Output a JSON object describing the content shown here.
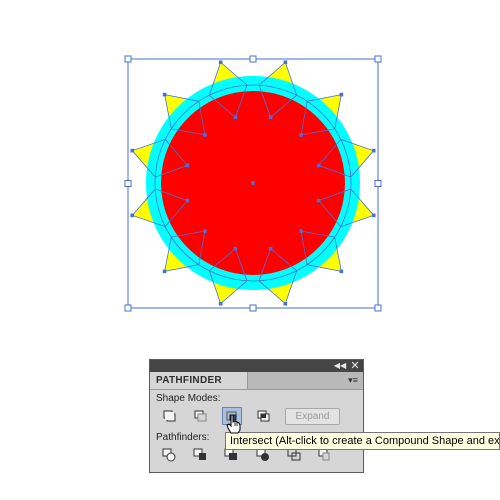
{
  "artwork": {
    "colors": {
      "rays": "#ffff00",
      "ring": "#00ffff",
      "disc": "#ff0000",
      "selection": "#4a6fd6"
    },
    "ray_count": 12
  },
  "pathfinder_panel": {
    "collapse_icon": "double-chevron-icon",
    "close_icon": "close-icon",
    "menu_icon": "panel-menu-icon",
    "tab_label": "PATHFINDER",
    "shape_modes_label": "Shape Modes:",
    "shape_modes": [
      {
        "icon": "unite-icon",
        "pressed": false
      },
      {
        "icon": "minus-front-icon",
        "pressed": false
      },
      {
        "icon": "intersect-icon",
        "pressed": true
      },
      {
        "icon": "exclude-icon",
        "pressed": false
      }
    ],
    "expand_label": "Expand",
    "pathfinders_label": "Pathfinders:",
    "pathfinders": [
      {
        "icon": "divide-icon"
      },
      {
        "icon": "trim-icon"
      },
      {
        "icon": "merge-icon"
      },
      {
        "icon": "crop-icon"
      },
      {
        "icon": "outline-icon"
      },
      {
        "icon": "minus-back-icon"
      }
    ]
  },
  "tooltip": {
    "text": "Intersect (Alt-click to create a Compound Shape and expand)"
  },
  "cursor": {
    "icon": "hand-pointer-icon"
  }
}
